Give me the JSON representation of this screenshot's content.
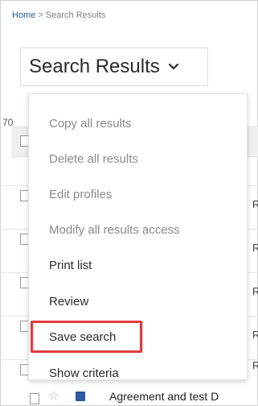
{
  "breadcrumb": {
    "home": "Home",
    "separator": ">",
    "current": "Search Results"
  },
  "title": {
    "text": "Search Results",
    "icon": "chevron-down-icon"
  },
  "background_list": {
    "count_partial": "70",
    "row_partial_letter": "R",
    "last_row_text": "Agreement and test D"
  },
  "menu": {
    "items": [
      {
        "label": "Copy all results",
        "enabled": false
      },
      {
        "label": "Delete all results",
        "enabled": false
      },
      {
        "label": "Edit profiles",
        "enabled": false
      },
      {
        "label": "Modify all results access",
        "enabled": false
      },
      {
        "label": "Print list",
        "enabled": true
      },
      {
        "label": "Review",
        "enabled": true
      },
      {
        "label": "Save search",
        "enabled": true,
        "highlighted": true
      },
      {
        "label": "Show criteria",
        "enabled": true
      }
    ]
  },
  "colors": {
    "link": "#1f5ca8",
    "highlight": "#e0393e",
    "disabled_text": "#8a8a8a"
  }
}
